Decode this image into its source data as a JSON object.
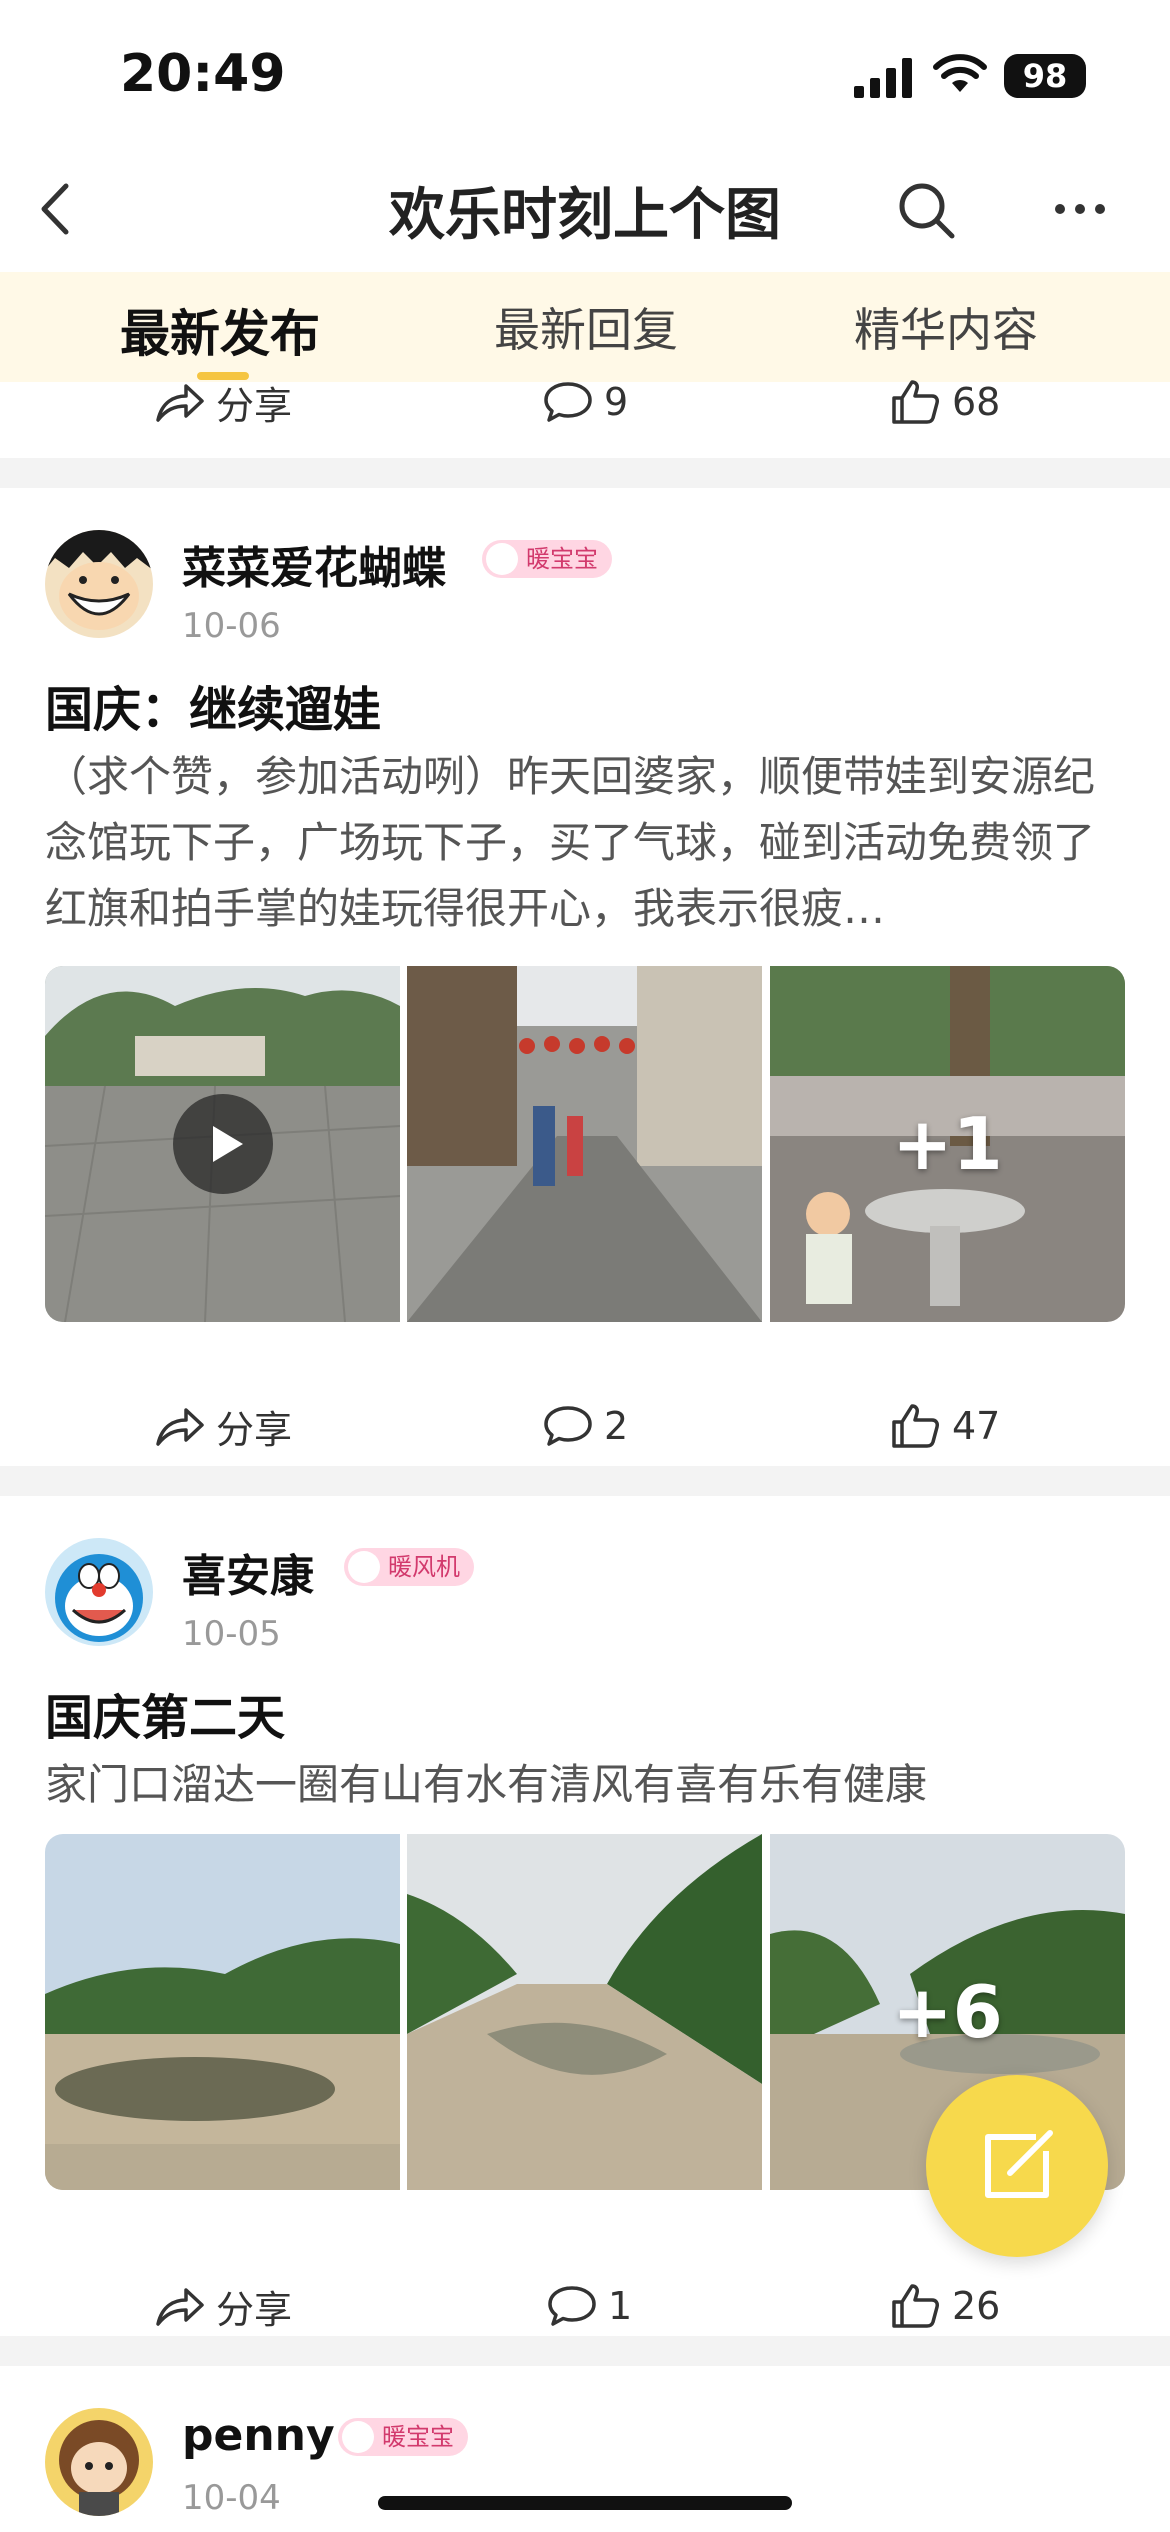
{
  "status_bar": {
    "time": "20:49",
    "battery": "98"
  },
  "header": {
    "title": "欢乐时刻上个图"
  },
  "tabs": [
    {
      "label": "最新发布",
      "active": true
    },
    {
      "label": "最新回复",
      "active": false
    },
    {
      "label": "精华内容",
      "active": false
    }
  ],
  "top_actions": {
    "share": "分享",
    "comments": "9",
    "likes": "68"
  },
  "posts": [
    {
      "username": "菜菜爱花蝴蝶",
      "badge": "暖宝宝",
      "date": "10-06",
      "title": "国庆：继续遛娃",
      "text": "（求个赞，参加活动咧）昨天回婆家，顺便带娃到安源纪念馆玩下子，广场玩下子，买了气球，碰到活动免费领了红旗和拍手掌的娃玩得很开心，我表示很疲…",
      "more_images": "+1",
      "share": "分享",
      "comments": "2",
      "likes": "47"
    },
    {
      "username": "喜安康",
      "badge": "暖风机",
      "date": "10-05",
      "title": "国庆第二天",
      "text": "家门口溜达一圈有山有水有清风有喜有乐有健康",
      "more_images": "+6",
      "share": "分享",
      "comments": "1",
      "likes": "26"
    },
    {
      "username": "penny",
      "badge": "暖宝宝",
      "date": "10-04"
    }
  ],
  "colors": {
    "accent": "#f5c542",
    "fab": "#f7d94c",
    "badge_bg": "#ffd6e3",
    "badge_text": "#d23a6d"
  }
}
